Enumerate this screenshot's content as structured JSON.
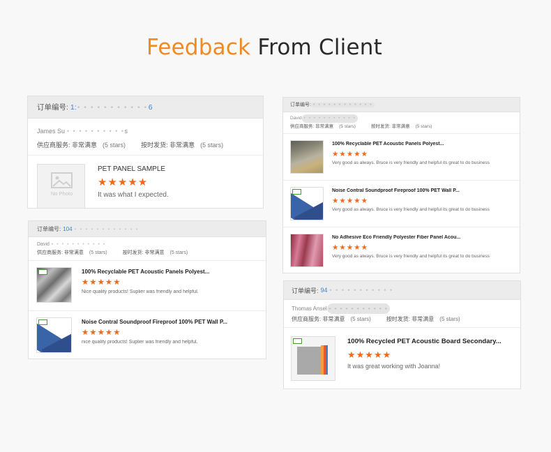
{
  "title": {
    "highlight": "Feedback",
    "rest": "From Client"
  },
  "colors": {
    "accent": "#f08a24",
    "star": "#f06a1a",
    "order_link": "#3a84d3"
  },
  "labels": {
    "order_no": "订单编号:",
    "service": "供应商服务:",
    "shipping": "按时发货:",
    "very_satisfied": "非常满意",
    "five_stars": "(5 stars)"
  },
  "stars": "★★★★★",
  "card1": {
    "order_visible_prefix": "1:",
    "order_visible_suffix": "6",
    "buyer_prefix": "James Su",
    "buyer_suffix": "s",
    "item": {
      "image_placeholder": "No Photo",
      "name": "PET PANEL SAMPLE",
      "review": "It was what I expected."
    }
  },
  "card2": {
    "order_visible_prefix": "104",
    "buyer_prefix": "David",
    "items": [
      {
        "image": "metal-curve-panels",
        "name": "100% Recyclable PET Acoustic Panels Polyest...",
        "review": "Nice quality products! Suplier was friendly and helpful."
      },
      {
        "image": "blue-felt-panel",
        "name": "Noise Contral Soundproof Fireproof 100% PET Wall P...",
        "review": "nice quality products! Suplier was friendly and helpful."
      }
    ]
  },
  "card3": {
    "buyer_prefix": "David",
    "items": [
      {
        "image": "grey-felt-roll",
        "name": "100% Recyclable PET Acoustic Panels Polyest...",
        "review": "Very good as always. Bruce is very friendly and helpful its great to do business"
      },
      {
        "image": "blue-felt-panel",
        "name": "Noise Contral Soundproof Fireproof 100% PET Wall P...",
        "review": "Very good as always. Bruce is very friendly and helpful its great to do business"
      },
      {
        "image": "pink-fiber-panels",
        "name": "No Adhesive Eco Friendly Polyester Fiber Panel Acou...",
        "review": "Very good as always. Bruce is very friendly and helpful its great to do business"
      }
    ]
  },
  "card4": {
    "order_visible_prefix": "94",
    "buyer_prefix": "Thomas Ansel",
    "item": {
      "image": "color-board-stack",
      "name": "100% Recycled PET Acoustic Board Secondary...",
      "review": "It was great working with Joanna!"
    }
  }
}
